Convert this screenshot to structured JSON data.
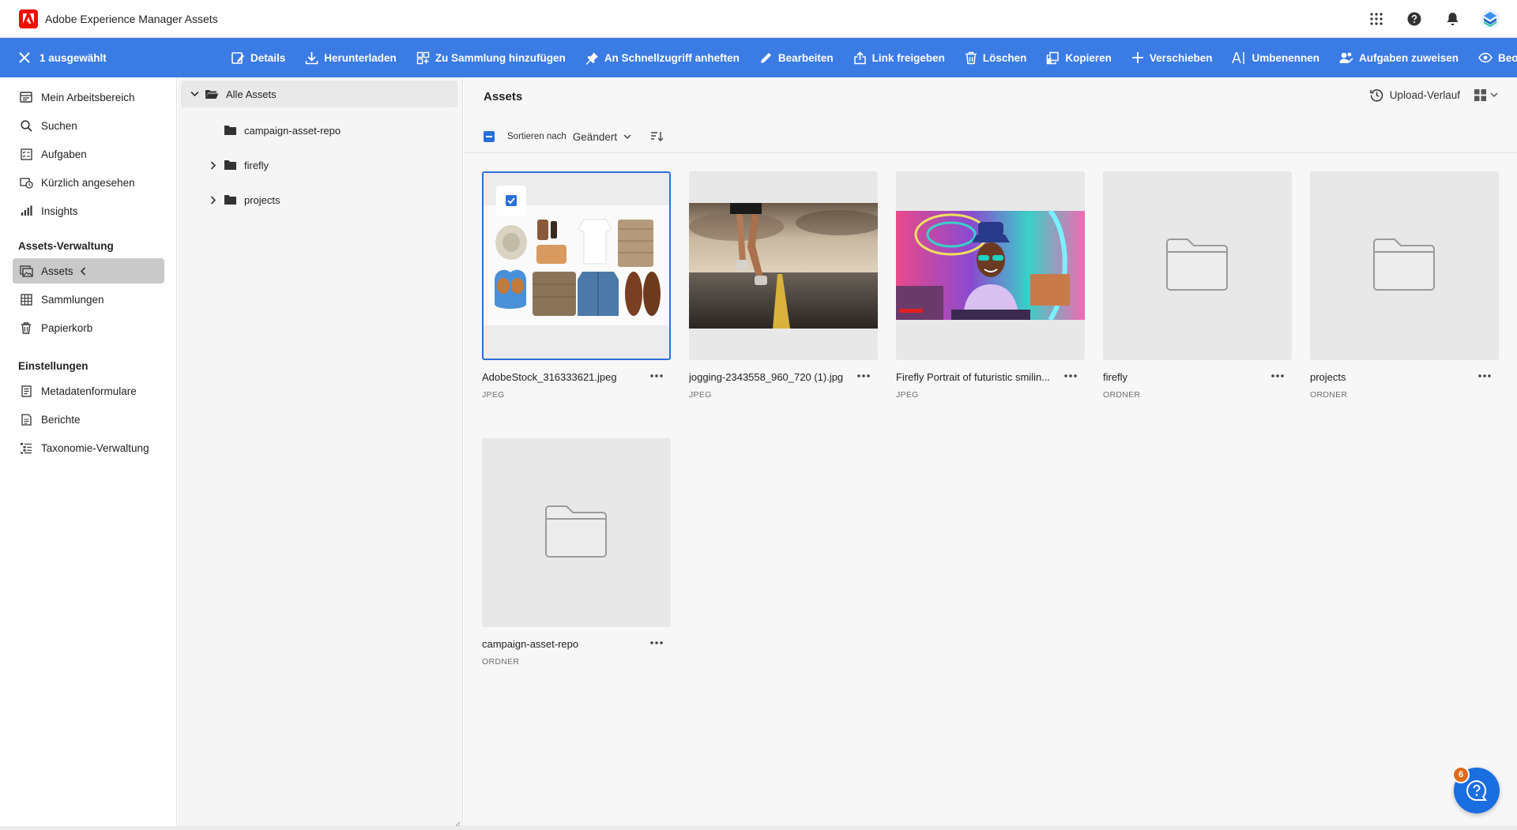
{
  "header": {
    "app_title": "Adobe Experience Manager Assets",
    "icons": [
      "apps-grid-icon",
      "help-icon",
      "notifications-bell-icon",
      "user-avatar"
    ]
  },
  "actionbar": {
    "selected_label": "1 ausgewählt",
    "actions": [
      {
        "label": "Details",
        "icon": "details-icon"
      },
      {
        "label": "Herunterladen",
        "icon": "download-icon"
      },
      {
        "label": "Zu Sammlung hinzufügen",
        "icon": "add-collection-icon"
      },
      {
        "label": "An Schnellzugriff anheften",
        "icon": "pin-icon"
      },
      {
        "label": "Bearbeiten",
        "icon": "edit-icon"
      },
      {
        "label": "Link freigeben",
        "icon": "share-icon"
      },
      {
        "label": "Löschen",
        "icon": "delete-icon"
      },
      {
        "label": "Kopieren",
        "icon": "copy-icon"
      },
      {
        "label": "Verschieben",
        "icon": "move-icon"
      },
      {
        "label": "Umbenennen",
        "icon": "rename-icon"
      },
      {
        "label": "Aufgaben zuweisen",
        "icon": "assign-tasks-icon"
      },
      {
        "label": "Beobachten",
        "icon": "watch-icon"
      }
    ]
  },
  "sidebar": {
    "items": [
      {
        "label": "Mein Arbeitsbereich",
        "icon": "workspace-icon"
      },
      {
        "label": "Suchen",
        "icon": "search-icon"
      },
      {
        "label": "Aufgaben",
        "icon": "tasks-icon"
      },
      {
        "label": "Kürzlich angesehen",
        "icon": "recent-icon"
      },
      {
        "label": "Insights",
        "icon": "insights-icon"
      }
    ],
    "asset_management_heading": "Assets-Verwaltung",
    "asset_items": [
      {
        "label": "Assets",
        "icon": "assets-icon",
        "active": true
      },
      {
        "label": "Sammlungen",
        "icon": "collections-icon"
      },
      {
        "label": "Papierkorb",
        "icon": "trash-icon"
      }
    ],
    "settings_heading": "Einstellungen",
    "settings_items": [
      {
        "label": "Metadatenformulare",
        "icon": "metadata-forms-icon"
      },
      {
        "label": "Berichte",
        "icon": "reports-icon"
      },
      {
        "label": "Taxonomie-Verwaltung",
        "icon": "taxonomy-icon"
      }
    ]
  },
  "tree": {
    "root": "Alle Assets",
    "children": [
      {
        "label": "campaign-asset-repo",
        "expandable": false
      },
      {
        "label": "firefly",
        "expandable": true
      },
      {
        "label": "projects",
        "expandable": true
      }
    ]
  },
  "main": {
    "title": "Assets",
    "upload_history": "Upload-Verlauf",
    "sort_label": "Sortieren nach",
    "sort_value": "Geändert",
    "cards": [
      {
        "name": "AdobeStock_316333621.jpeg",
        "type": "JPEG",
        "kind": "image-flatlay",
        "selected": true
      },
      {
        "name": "jogging-2343558_960_720 (1).jpg",
        "type": "JPEG",
        "kind": "image-jogging",
        "selected": false
      },
      {
        "name": "Firefly Portrait of futuristic smilin...",
        "type": "JPEG",
        "kind": "image-portrait",
        "selected": false
      },
      {
        "name": "firefly",
        "type": "ORDNER",
        "kind": "folder",
        "selected": false
      },
      {
        "name": "projects",
        "type": "ORDNER",
        "kind": "folder",
        "selected": false
      },
      {
        "name": "campaign-asset-repo",
        "type": "ORDNER",
        "kind": "folder",
        "selected": false
      }
    ]
  },
  "help": {
    "badge": "6"
  },
  "colors": {
    "accent": "#3b7be4",
    "selection": "#2b6fd8",
    "brand": "#eb1000",
    "badge": "#e06a1a"
  }
}
